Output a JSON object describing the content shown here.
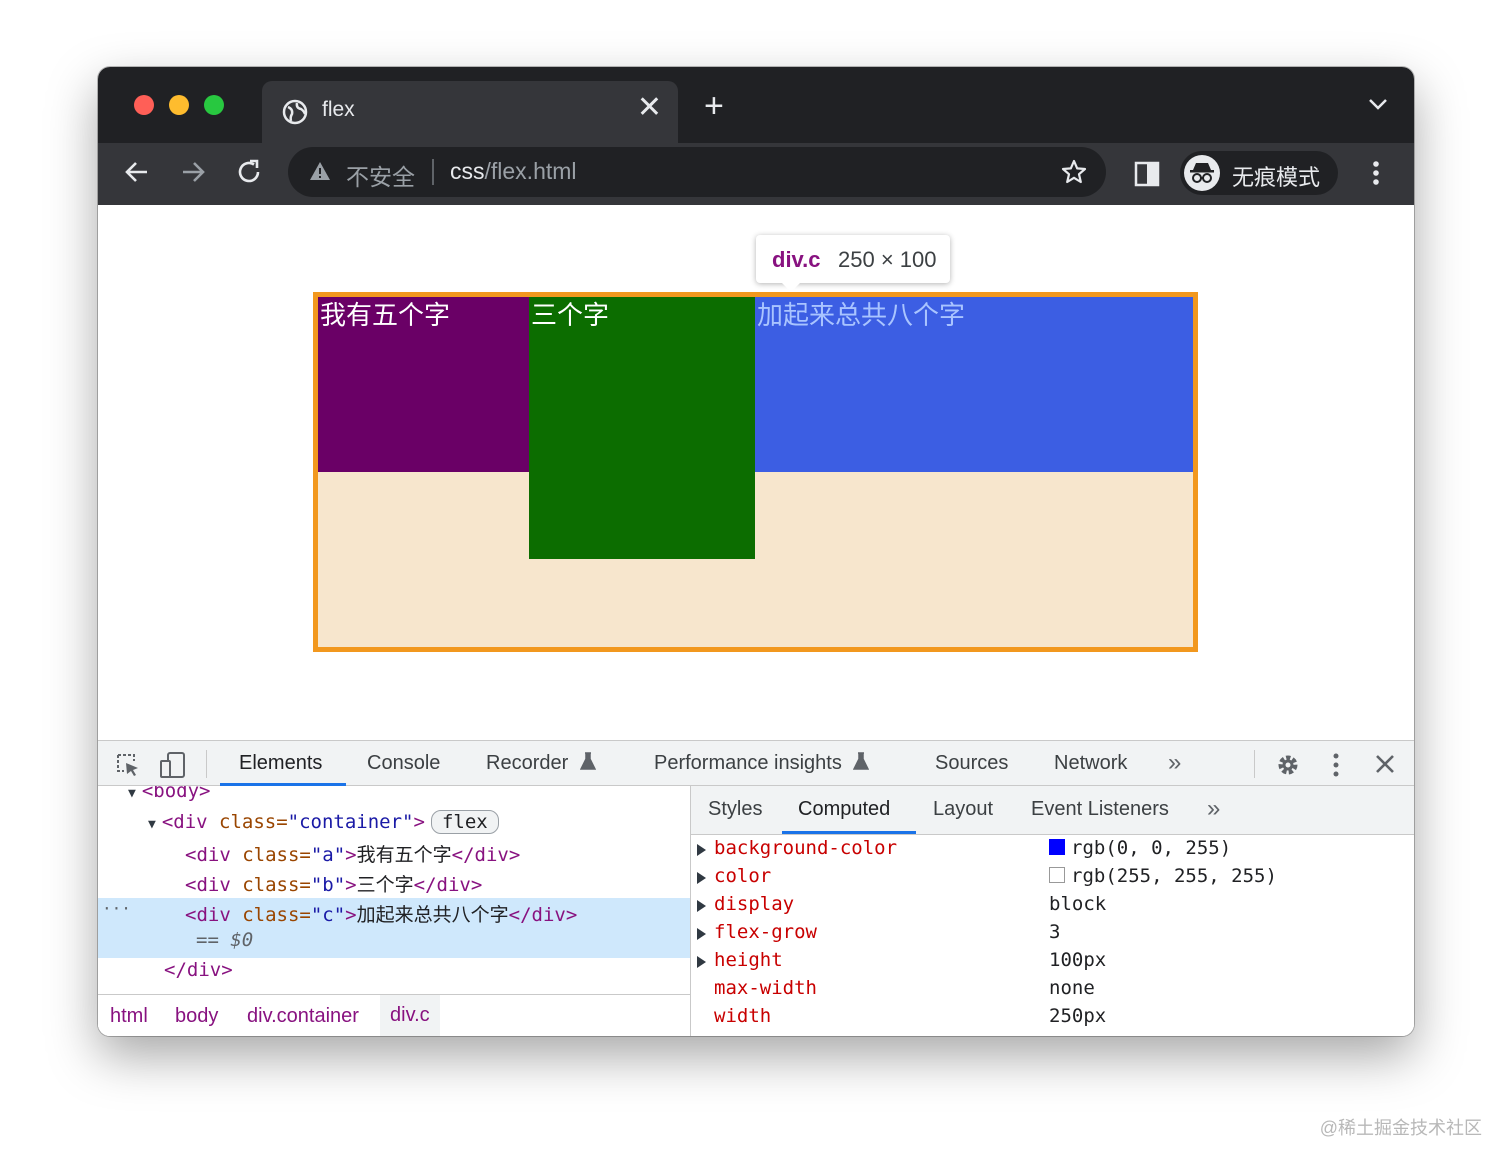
{
  "window": {
    "traffic_lights": {
      "close": "#ff5f57",
      "minimize": "#febc2e",
      "zoom": "#28c840"
    }
  },
  "tab": {
    "title": "flex",
    "close_glyph": "✕",
    "new_tab_glyph": "+"
  },
  "address_bar": {
    "security_label": "不安全",
    "url_host": "css",
    "url_path": "/flex.html"
  },
  "profile": {
    "label": "无痕模式"
  },
  "page": {
    "tooltip": {
      "name": "div.c",
      "size": "250 × 100"
    },
    "boxes": {
      "a": {
        "text": "我有五个字",
        "color": "#6a0066"
      },
      "b": {
        "text": "三个字",
        "color": "#0c6d00"
      },
      "c": {
        "text": "加起来总共八个字",
        "color": "#3c5ee3"
      }
    },
    "container_colors": {
      "background": "#f7e6cd",
      "border": "#f2981e"
    }
  },
  "devtools": {
    "tabs": [
      "Elements",
      "Console",
      "Recorder",
      "Performance insights",
      "Sources",
      "Network"
    ],
    "more_glyph": "»",
    "elements": {
      "body_line": "<body>",
      "container_open_tag": "<div ",
      "container_attr": "class=",
      "container_val": "\"container\"",
      "container_close": ">",
      "flex_badge": "flex",
      "div_a": {
        "open": "<div ",
        "attr": "class=",
        "val": "\"a\"",
        "mid": ">",
        "text": "我有五个字",
        "close": "</div>"
      },
      "div_b": {
        "open": "<div ",
        "attr": "class=",
        "val": "\"b\"",
        "mid": ">",
        "text": "三个字",
        "close": "</div>"
      },
      "div_c": {
        "open": "<div ",
        "attr": "class=",
        "val": "\"c\"",
        "mid": ">",
        "text": "加起来总共八个字",
        "close": "</div>"
      },
      "dollar_line": "== $0",
      "container_end": "</div>",
      "ellipsis": "···"
    },
    "breadcrumbs": [
      "html",
      "body",
      "div.container",
      "div.c"
    ],
    "sub_tabs": [
      "Styles",
      "Computed",
      "Layout",
      "Event Listeners"
    ],
    "computed": [
      {
        "name": "background-color",
        "value": "rgb(0, 0, 255)",
        "swatch": "#0000ff",
        "expandable": true
      },
      {
        "name": "color",
        "value": "rgb(255, 255, 255)",
        "swatch": "#ffffff",
        "expandable": true
      },
      {
        "name": "display",
        "value": "block",
        "expandable": true
      },
      {
        "name": "flex-grow",
        "value": "3",
        "expandable": true
      },
      {
        "name": "height",
        "value": "100px",
        "expandable": true
      },
      {
        "name": "max-width",
        "value": "none",
        "expandable": false
      },
      {
        "name": "width",
        "value": "250px",
        "expandable": false
      }
    ]
  },
  "watermark": "@稀土掘金技术社区"
}
